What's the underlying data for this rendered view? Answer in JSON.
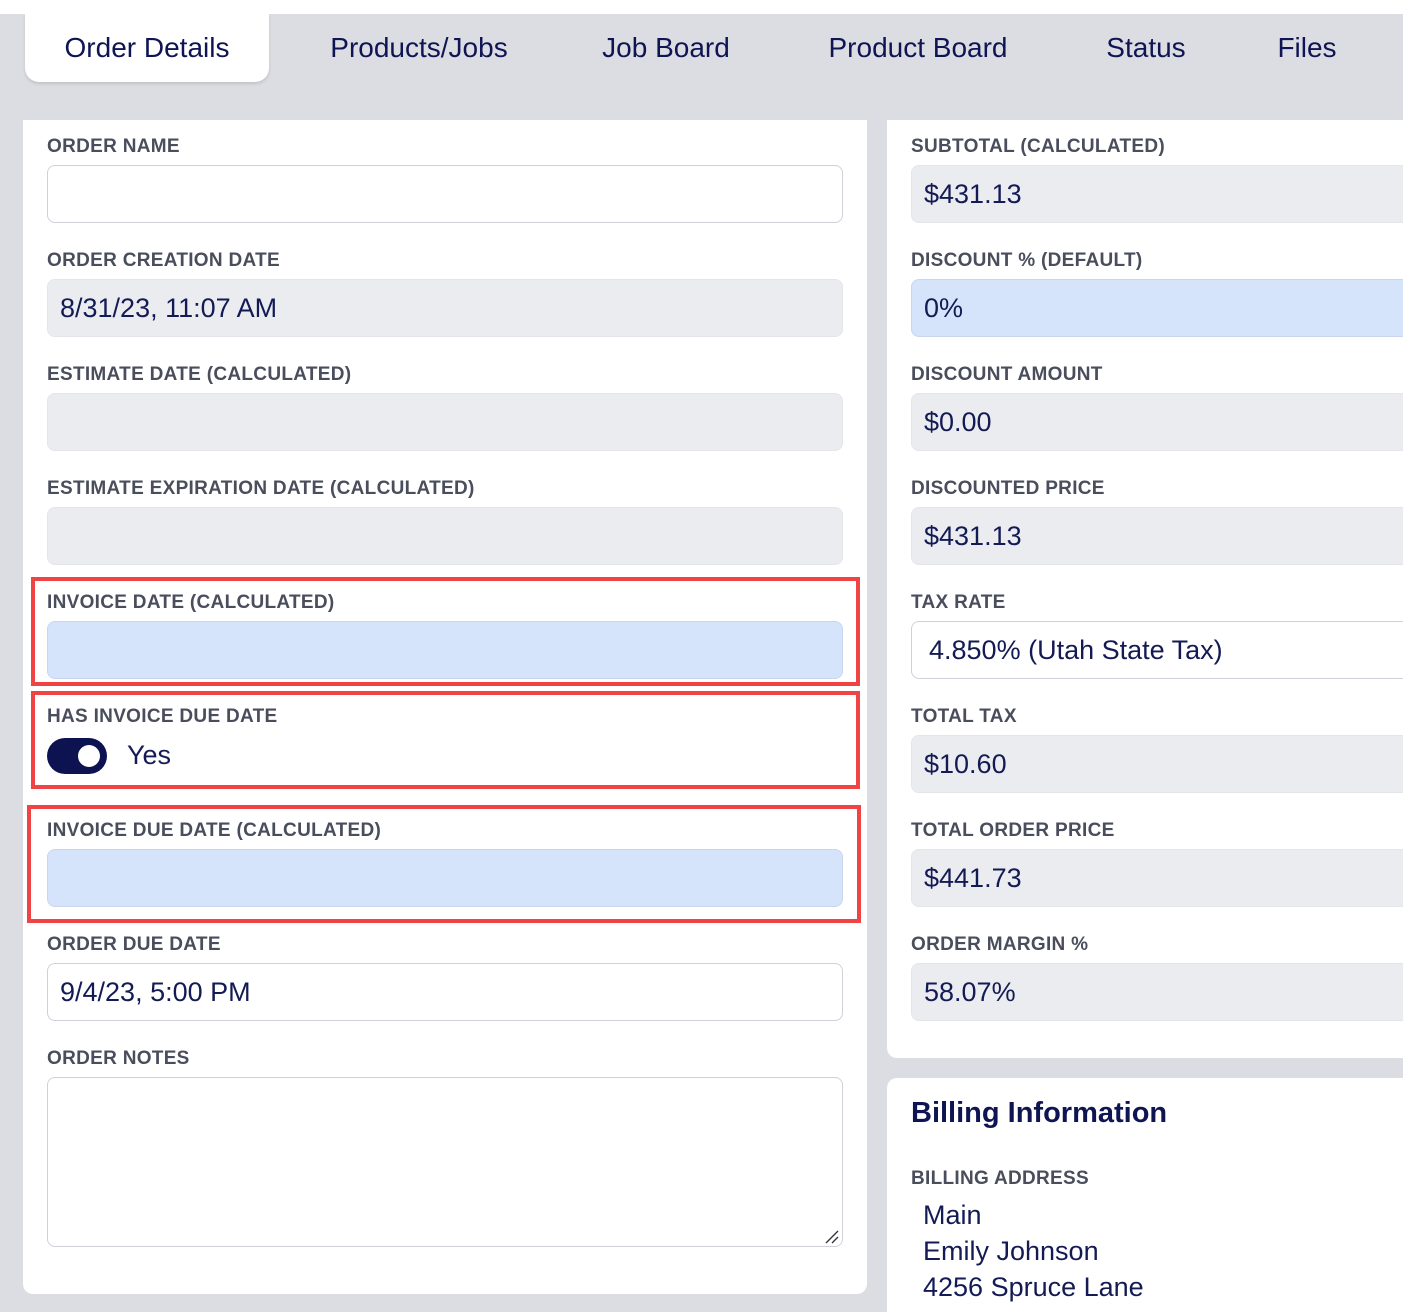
{
  "tabs": [
    {
      "label": "Order Details",
      "active": true
    },
    {
      "label": "Products/Jobs",
      "active": false
    },
    {
      "label": "Job Board",
      "active": false
    },
    {
      "label": "Product Board",
      "active": false
    },
    {
      "label": "Status",
      "active": false
    },
    {
      "label": "Files",
      "active": false
    }
  ],
  "left": {
    "order_name": {
      "label": "ORDER NAME",
      "value": ""
    },
    "order_creation_date": {
      "label": "ORDER CREATION DATE",
      "value": "8/31/23, 11:07 AM"
    },
    "estimate_date": {
      "label": "ESTIMATE DATE (CALCULATED)",
      "value": ""
    },
    "estimate_expiration_date": {
      "label": "ESTIMATE EXPIRATION DATE (CALCULATED)",
      "value": ""
    },
    "invoice_date": {
      "label": "INVOICE DATE (CALCULATED)",
      "value": ""
    },
    "has_invoice_due_date": {
      "label": "HAS INVOICE DUE DATE",
      "value": "Yes",
      "checked": true
    },
    "invoice_due_date": {
      "label": "INVOICE DUE DATE (CALCULATED)",
      "value": ""
    },
    "order_due_date": {
      "label": "ORDER DUE DATE",
      "value": "9/4/23, 5:00 PM"
    },
    "order_notes": {
      "label": "ORDER NOTES",
      "value": ""
    }
  },
  "right": {
    "subtotal": {
      "label": "SUBTOTAL (CALCULATED)",
      "value": "$431.13"
    },
    "discount_pct": {
      "label": "DISCOUNT % (DEFAULT)",
      "value": "0%"
    },
    "discount_amount": {
      "label": "DISCOUNT AMOUNT",
      "value": "$0.00"
    },
    "discounted_price": {
      "label": "DISCOUNTED PRICE",
      "value": "$431.13"
    },
    "tax_rate": {
      "label": "TAX RATE",
      "value": "4.850% (Utah State Tax)"
    },
    "total_tax": {
      "label": "TOTAL TAX",
      "value": "$10.60"
    },
    "total_order_price": {
      "label": "TOTAL ORDER PRICE",
      "value": "$441.73"
    },
    "order_margin": {
      "label": "ORDER MARGIN %",
      "value": "58.07%"
    }
  },
  "billing": {
    "title": "Billing Information",
    "address_label": "BILLING ADDRESS",
    "address_lines": [
      "Main",
      "Emily Johnson",
      "4256 Spruce Lane"
    ]
  },
  "colors": {
    "highlight": "#f04444",
    "navy": "#0d1350",
    "field_blue": "#d6e4fb",
    "field_gray": "#ebecf0"
  }
}
